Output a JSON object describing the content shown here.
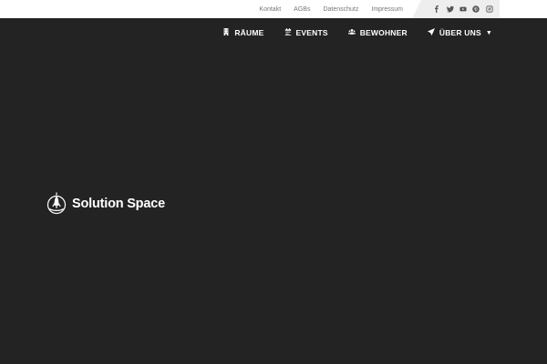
{
  "topbar": {
    "links": [
      "Kontakt",
      "AGBs",
      "Datenschutz",
      "Impressum"
    ],
    "social": [
      "facebook-icon",
      "twitter-icon",
      "youtube-icon",
      "pinterest-icon",
      "instagram-icon"
    ]
  },
  "nav": {
    "items": [
      {
        "label": "RÄUME",
        "icon": "building-icon"
      },
      {
        "label": "EVENTS",
        "icon": "calendar-icon"
      },
      {
        "label": "BEWOHNER",
        "icon": "users-icon"
      },
      {
        "label": "ÜBER UNS",
        "icon": "paper-plane-icon"
      }
    ]
  },
  "brand": {
    "name": "Solution Space"
  },
  "colors": {
    "background": "#232323",
    "topbar": "#ffffff",
    "social_bg": "#eeeeee",
    "nav_text": "#ffffff"
  }
}
